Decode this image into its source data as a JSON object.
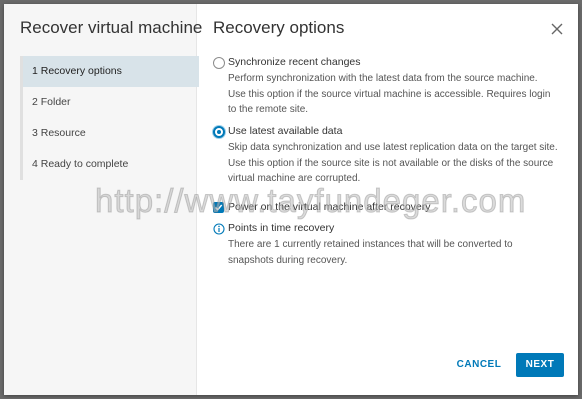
{
  "wizard": {
    "title": "Recover virtual machine",
    "steps": [
      {
        "label": "1  Recovery options"
      },
      {
        "label": "2  Folder"
      },
      {
        "label": "3  Resource"
      },
      {
        "label": "4  Ready to complete"
      }
    ]
  },
  "page": {
    "title": "Recovery options",
    "options": [
      {
        "label": "Synchronize recent changes",
        "description": "Perform synchronization with the latest data from the source machine. Use this option if the source virtual machine is accessible. Requires login to the remote site."
      },
      {
        "label": "Use latest available data",
        "description": "Skip data synchronization and use latest replication data on the target site. Use this option if the source site is not available or the disks of the source virtual machine are corrupted."
      }
    ],
    "power_on_label": "Power on the virtual machine after recovery",
    "info": {
      "title": "Points in time recovery",
      "text": "There are 1 currently retained instances that will be converted to snapshots during recovery."
    }
  },
  "footer": {
    "cancel_label": "CANCEL",
    "next_label": "NEXT"
  },
  "watermark": "http://www.tayfundeger.com",
  "colors": {
    "accent": "#0079b8",
    "active_step_bg": "#d8e3e9"
  }
}
